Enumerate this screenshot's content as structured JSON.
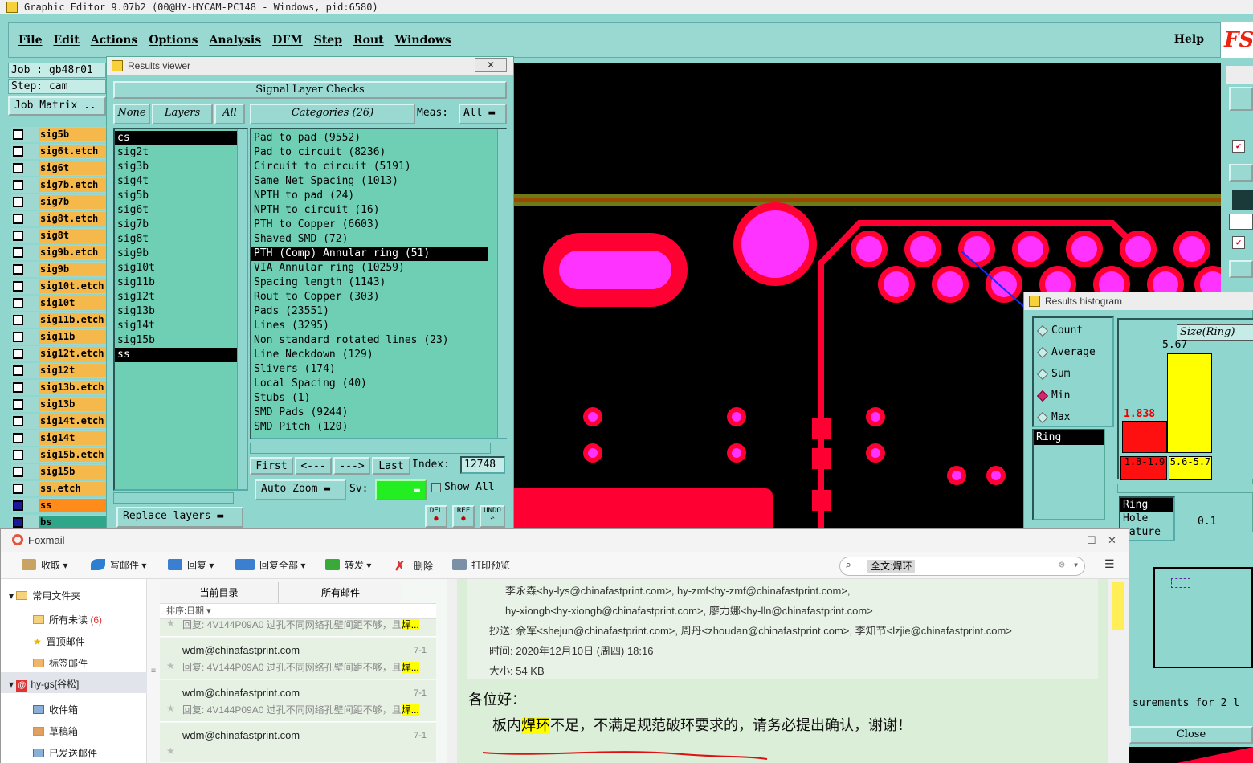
{
  "app": {
    "title": "Graphic Editor 9.07b2 (00@HY-HYCAM-PC148 - Windows, pid:6580)",
    "menu": [
      "File",
      "Edit",
      "Actions",
      "Options",
      "Analysis",
      "DFM",
      "Step",
      "Rout",
      "Windows"
    ],
    "help": "Help",
    "logo_text": "FS"
  },
  "job": {
    "job_line": "Job : gb48r01",
    "step_line": "Step: cam",
    "matrix_button": "Job Matrix ..",
    "layers": [
      "sig5b",
      "sig6t.etch",
      "sig6t",
      "sig7b.etch",
      "sig7b",
      "sig8t.etch",
      "sig8t",
      "sig9b.etch",
      "sig9b",
      "sig10t.etch",
      "sig10t",
      "sig11b.etch",
      "sig11b",
      "sig12t.etch",
      "sig12t",
      "sig13b.etch",
      "sig13b",
      "sig14t.etch",
      "sig14t",
      "sig15b.etch",
      "sig15b",
      "ss.etch",
      "ss",
      "bs"
    ]
  },
  "results_viewer": {
    "title": "Results viewer",
    "header": "Signal Layer Checks",
    "none_btn": "None",
    "layers_btn": "Layers",
    "all_btn": "All",
    "categories_btn": "Categories (26)",
    "meas_label": "Meas:",
    "meas_value": "All",
    "layer_list": [
      "cs",
      "sig2t",
      "sig3b",
      "sig4t",
      "sig5b",
      "sig6t",
      "sig7b",
      "sig8t",
      "sig9b",
      "sig10t",
      "sig11b",
      "sig12t",
      "sig13b",
      "sig14t",
      "sig15b",
      "ss"
    ],
    "selected_layers": [
      "cs",
      "ss"
    ],
    "categories": [
      "Pad to pad (9552)",
      "Pad to circuit (8236)",
      "Circuit to circuit (5191)",
      "Same Net Spacing (1013)",
      "NPTH to pad (24)",
      "NPTH to circuit (16)",
      "PTH to Copper (6603)",
      "Shaved SMD (72)",
      "PTH (Comp) Annular ring (51)",
      "VIA Annular ring (10259)",
      "Spacing length (1143)",
      "Rout to Copper (303)",
      "Pads (23551)",
      "Lines (3295)",
      "Non standard rotated lines (23)",
      "Line Neckdown (129)",
      "Slivers (174)",
      "Local Spacing (40)",
      "Stubs (1)",
      "SMD Pads (9244)",
      "SMD Pitch (120)"
    ],
    "selected_category": "PTH (Comp) Annular ring (51)",
    "first_btn": "First",
    "prev_btn": "<---",
    "next_btn": "--->",
    "last_btn": "Last",
    "index_label": "Index:",
    "index_value": "12748",
    "autozoom_btn": "Auto Zoom",
    "sv_label": "Sv:",
    "showall_label": "Show All",
    "replace_btn": "Replace layers",
    "del_label": "DEL",
    "ref_label": "REF",
    "undo_label": "UNDO"
  },
  "histogram": {
    "title": "Results histogram",
    "options": [
      "Count",
      "Average",
      "Sum",
      "Min",
      "Max"
    ],
    "selected_option": "Min",
    "list_item": "Ring",
    "chart_title": "Size(Ring)",
    "bar1_value": "1.838",
    "bar2_value": "5.67",
    "bin1_label": "1.8-1.9",
    "bin2_label": "5.6-5.7",
    "lower_list": [
      "Ring",
      "Hole",
      "eature"
    ],
    "step_value": "0.1",
    "measurements_text": "surements for 2 l",
    "close_btn": "Close"
  },
  "foxmail": {
    "title": "Foxmail",
    "toolbar": [
      "收取",
      "写邮件",
      "回复",
      "回复全部",
      "转发",
      "删除",
      "打印预览"
    ],
    "search_value": "全文:焊环",
    "folders": {
      "common": "常用文件夹",
      "unread": "所有未读",
      "unread_count": "(6)",
      "pinned": "置顶邮件",
      "tagged": "标签邮件",
      "account": "hy-gs[谷松]",
      "inbox": "收件箱",
      "drafts": "草稿箱",
      "sent": "已发送邮件"
    },
    "list_tabs": [
      "当前目录",
      "所有邮件"
    ],
    "sort_label": "排序:日期",
    "mails": [
      {
        "from": "wdm@chinafastprint.com",
        "date": "7-1",
        "subject": "回复: 4V144P09A0 过孔不同网络孔壁间距不够，且",
        "highlight": "焊..."
      },
      {
        "from": "wdm@chinafastprint.com",
        "date": "7-1",
        "subject": "回复: 4V144P09A0 过孔不同网络孔壁间距不够，且",
        "highlight": "焊..."
      },
      {
        "from": "wdm@chinafastprint.com",
        "date": "7-1",
        "subject": "回复: 4V144P09A0 过孔不同网络孔壁间距不够，且",
        "highlight": "焊..."
      },
      {
        "from": "wdm@chinafastprint.com",
        "date": "7-1",
        "subject": "",
        "highlight": ""
      }
    ],
    "header_lines": [
      "李永森<hy-lys@chinafastprint.com>, hy-zmf<hy-zmf@chinafastprint.com>,",
      "hy-xiongb<hy-xiongb@chinafastprint.com>, 廖力娜<hy-lln@chinafastprint.com>",
      "抄送: 佘军<shejun@chinafastprint.com>, 周丹<zhoudan@chinafastprint.com>, 李知节<lzjie@chinafastprint.com>",
      "时间: 2020年12月10日 (周四) 18:16",
      "大小: 54 KB"
    ],
    "greeting": "各位好：",
    "body_pre": "板内",
    "body_hl": "焊环",
    "body_post": "不足，不满足规范破环要求的，请务必提出确认，谢谢！"
  },
  "colors": {
    "panel": "#8fd6cf",
    "list": "#6fcfb5",
    "copper": "#ff0033",
    "pad_center": "#ff33ff",
    "layer_orange": "#f5b84a"
  }
}
